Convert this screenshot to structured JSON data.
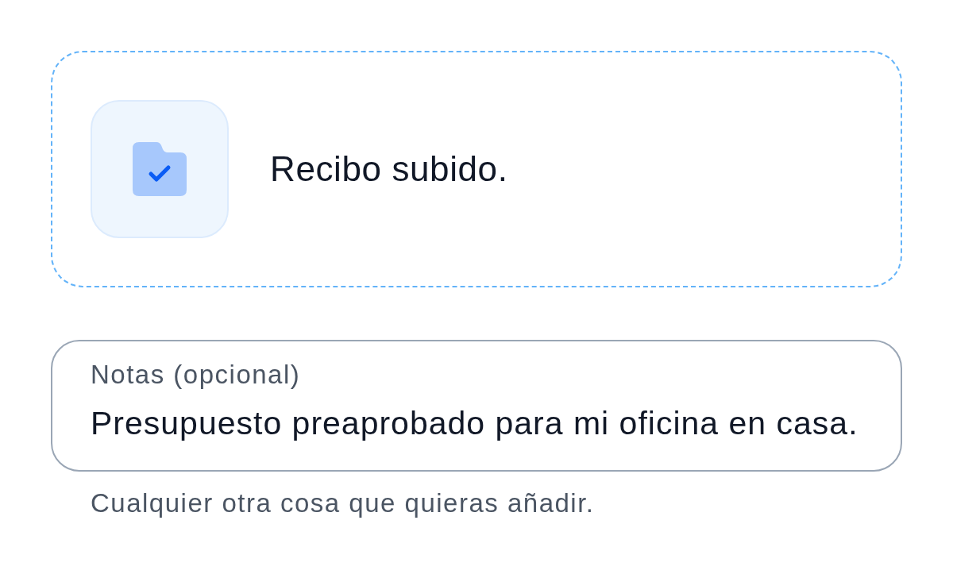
{
  "upload": {
    "status": "Recibo subido."
  },
  "notes": {
    "label": "Notas (opcional)",
    "value": "Presupuesto preaprobado para mi oficina en casa.",
    "helper": "Cualquier otra cosa que quieras añadir."
  }
}
